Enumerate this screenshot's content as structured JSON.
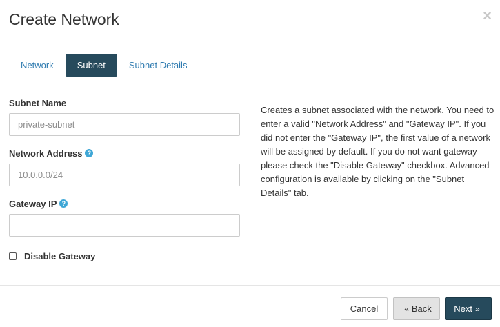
{
  "dialog": {
    "title": "Create Network",
    "close_glyph": "×"
  },
  "tabs": [
    {
      "label": "Network",
      "active": false
    },
    {
      "label": "Subnet",
      "active": true
    },
    {
      "label": "Subnet Details",
      "active": false
    }
  ],
  "form": {
    "subnet_name": {
      "label": "Subnet Name",
      "value": "",
      "placeholder": "private-subnet"
    },
    "network_address": {
      "label": "Network Address",
      "value": "",
      "placeholder": "10.0.0.0/24",
      "help_icon": "?"
    },
    "gateway_ip": {
      "label": "Gateway IP",
      "value": "",
      "placeholder": "",
      "help_icon": "?"
    },
    "disable_gateway": {
      "label": "Disable Gateway",
      "checked": false
    }
  },
  "help_text": "Creates a subnet associated with the network. You need to enter a valid \"Network Address\" and \"Gateway IP\". If you did not enter the \"Gateway IP\", the first value of a network will be assigned by default. If you do not want gateway please check the \"Disable Gateway\" checkbox. Advanced configuration is available by clicking on the \"Subnet Details\" tab.",
  "footer": {
    "cancel_label": "Cancel",
    "back_glyph": "«",
    "back_label": "Back",
    "next_label": "Next",
    "next_glyph": "»"
  },
  "colors": {
    "primary": "#264a5c",
    "link": "#2f7bb0",
    "help_icon": "#3fa7d6"
  }
}
